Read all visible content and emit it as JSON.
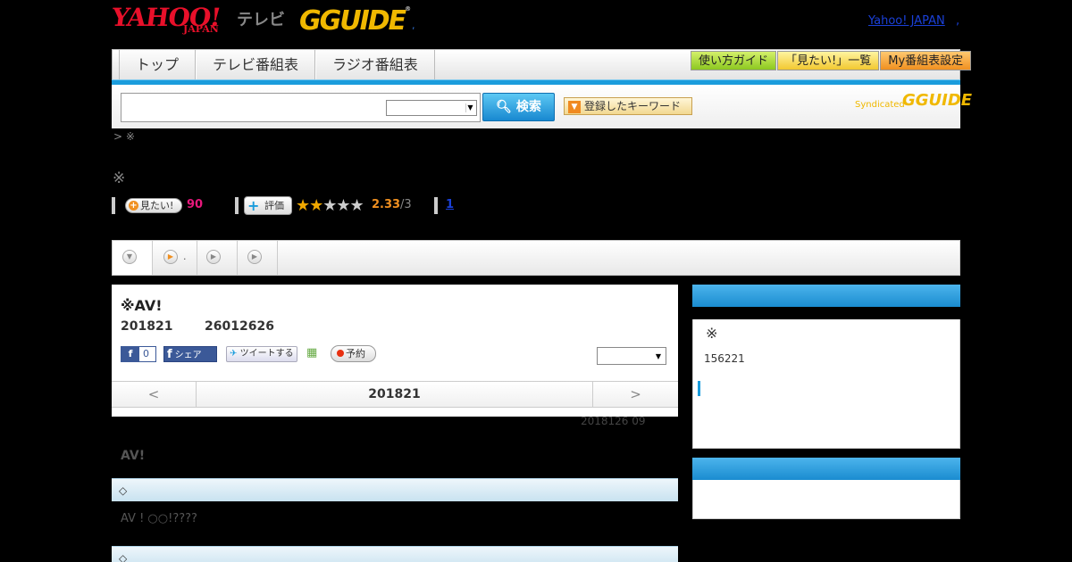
{
  "header": {
    "yahoo_logo": "YAHOO!",
    "japan_logo": "JAPAN",
    "tv_logo": "テレビ",
    "gguide_logo": "GUIDE",
    "dot": ",",
    "yahoo_japan_link": "Yahoo! JAPAN",
    "yahoo_link_dot": ","
  },
  "nav": {
    "tabs": [
      "トップ",
      "テレビ番組表",
      "ラジオ番組表"
    ],
    "right_buttons": [
      "使い方ガイド",
      "「見たい!」一覧",
      "My番組表設定"
    ]
  },
  "search": {
    "button_label": "検索",
    "keyword_button": "登録したキーワード",
    "syndicated": "Syndicated",
    "syn_logo": "GUIDE"
  },
  "breadcrumb": "> ※",
  "kome_mark": "※",
  "rating": {
    "mitai_label": "見たい!",
    "mitai_count": "90",
    "hyouka_label": "評価",
    "stars_on": "★★",
    "stars_off": "★★★",
    "score": "2.33",
    "score_max": "/3",
    "count_link": "1"
  },
  "subtabs": {
    "tab2_text": "."
  },
  "program": {
    "title": "※AV!",
    "date": "201821",
    "time": "26012626",
    "fb_like_count": "0",
    "fb_share_label": "シェア",
    "tweet_label": "ツイートする",
    "yoyaku_label": "予約",
    "date_nav_prev": "<",
    "date_nav_date": "201821",
    "date_nav_next": ">",
    "updated": "2018126  09"
  },
  "content": {
    "av_label": "AV!",
    "section1_head": "◇",
    "section1_text": "AV ! ○○!????",
    "section2_head": "◇"
  },
  "sidebar": {
    "kome": "※",
    "number": "156221"
  },
  "colors": {
    "accent_blue": "#1a9cdc",
    "brand_red": "#e8102a",
    "gguide_yellow": "#f0b800",
    "mitai_pink": "#e8187c",
    "score_orange": "#f09020"
  }
}
